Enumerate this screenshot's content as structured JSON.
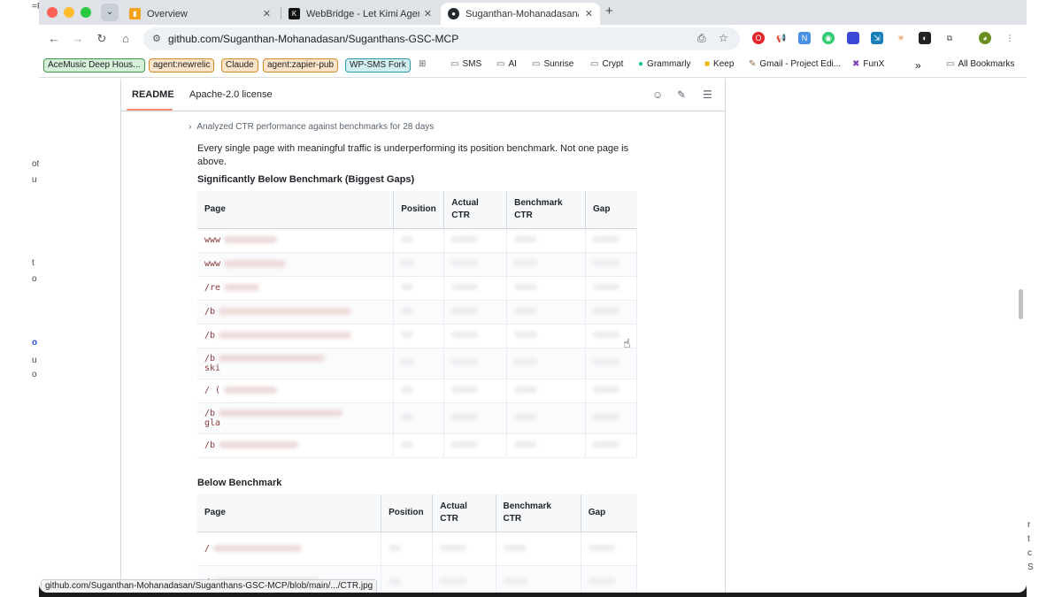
{
  "tabs": [
    {
      "title": "Overview",
      "icon": "analytics-icon",
      "active": false
    },
    {
      "title": "WebBridge - Let Kimi Agent D",
      "icon": "kimi-icon",
      "active": false
    },
    {
      "title": "Suganthan-Mohanadasan/Su",
      "icon": "github-icon",
      "active": true
    }
  ],
  "toolbar": {
    "url": "github.com/Suganthan-Mohanadasan/Suganthans-GSC-MCP"
  },
  "bookmarks": {
    "chips": [
      "AceMusic Deep Hous...",
      "agent:newrelic",
      "Claude",
      "agent:zapier-pub",
      "WP-SMS Fork"
    ],
    "folders": [
      "SMS",
      "AI",
      "Sunrise",
      "Crypt"
    ],
    "links": [
      "Grammarly",
      "Keep",
      "Gmail - Project Edi...",
      "FunX"
    ],
    "all_bookmarks": "All Bookmarks",
    "more": "»"
  },
  "readme": {
    "tab_readme": "README",
    "tab_license": "Apache-2.0 license",
    "analyzed": "Analyzed CTR performance against benchmarks for 28 days",
    "intro": "Every single page with meaningful traffic is underperforming its position benchmark. Not one page is above.",
    "h_significant": "Significantly Below Benchmark (Biggest Gaps)",
    "h_below": "Below Benchmark",
    "columns": {
      "page": "Page",
      "position": "Position",
      "actual_line1": "Actual",
      "actual_line2": "CTR",
      "bench_line1": "Benchmark",
      "bench_line2": "CTR",
      "gap": "Gap"
    },
    "sig_rows": [
      {
        "prefix": "www"
      },
      {
        "prefix": "www"
      },
      {
        "prefix": "/re"
      },
      {
        "prefix": "/b"
      },
      {
        "prefix": "/b"
      },
      {
        "prefix": "/b",
        "line2": "ski"
      },
      {
        "prefix": "/ ("
      },
      {
        "prefix": "/b",
        "line2": "gla"
      },
      {
        "prefix": "/b"
      }
    ],
    "below_rows": [
      {
        "prefix": "/"
      },
      {
        "prefix": "/"
      }
    ]
  },
  "statusbar": "github.com/Suganthan-Mohanadasan/Suganthans-GSC-MCP/blob/main/.../CTR.jpg"
}
